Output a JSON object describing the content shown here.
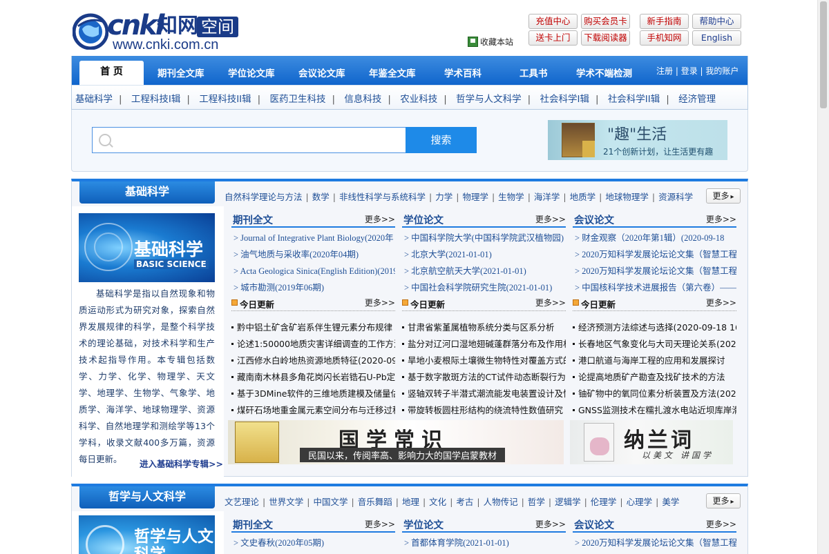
{
  "header": {
    "logo_cnki": "cnki",
    "logo_cn": "知网",
    "logo_kongjian": "空间",
    "logo_url": "www.cnki.com.cn",
    "bookmark": "收藏本站",
    "top_buttons": [
      "充值中心",
      "购买会员卡",
      "新手指南",
      "帮助中心",
      "送卡上门",
      "下载阅读器",
      "手机知网",
      "English"
    ]
  },
  "nav": {
    "home": "首 页",
    "items": [
      "期刊全文库",
      "学位论文库",
      "会议论文库",
      "年鉴全文库",
      "学术百科",
      "工具书",
      "学术不端检测"
    ],
    "user": [
      "注册",
      "登录",
      "我的账户"
    ],
    "subnav": [
      "基础科学",
      "工程科技I辑",
      "工程科技II辑",
      "医药卫生科技",
      "信息科技",
      "农业科技",
      "哲学与人文科学",
      "社会科学I辑",
      "社会科学II辑",
      "经济管理"
    ]
  },
  "search": {
    "placeholder": "",
    "button": "搜索",
    "ad_title": "\"趣\"生活",
    "ad_sub": "21个创新计划，让生活更有趣"
  },
  "section1": {
    "title": "基础科学",
    "links": [
      "自然科学理论与方法",
      "数学",
      "非线性科学与系统科学",
      "力学",
      "物理学",
      "生物学",
      "海洋学",
      "地质学",
      "地球物理学",
      "资源科学"
    ],
    "more": "更多",
    "banner_cn": "基础科学",
    "banner_en": "BASIC SCIENCE",
    "description": "基础科学是指以自然现象和物质运动形式为研究对象，探索自然界发展规律的科学，是整个科学技术的理论基础，对技术科学和生产技术起指导作用。本专辑包括数学、力学、化学、物理学、天文学、地理学、生物学、气象学、地质学、海洋学、地球物理学、资源科学、自然地理学和测绘学等13个学科，收录文献400多万篇，资源每日更新。",
    "enter": "进入基础科学专辑>>",
    "columns": [
      {
        "title": "期刊全文",
        "more": "更多>>",
        "items": [
          "> Journal of Integrative Plant Biology(2020年",
          "> 油气地质与采收率(2020年04期)",
          "> Acta Geologica Sinica(English Edition)(2019",
          "> 城市勘测(2019年06期)"
        ],
        "today_title": "今日更新",
        "today_more": "更多>>",
        "today": [
          "黔中铝土矿含矿岩系伴生锂元素分布规律",
          "论述1:50000地质灾害详细调查的工作方法",
          "江西修水白岭地热资源地质特征(2020-09-",
          "藏南南木林县多角花岗闪长岩锆石U-Pb定年",
          "基于3DMine软件的三维地质建模及储量估",
          "煤矸石场地重金属元素空间分布与迁移过程"
        ]
      },
      {
        "title": "学位论文",
        "more": "更多>>",
        "items": [
          "> 中国科学院大学(中国科学院武汉植物园)",
          "> 北京大学(2021-01-01)",
          "> 北京航空航天大学(2021-01-01)",
          "> 中国社会科学院研究生院(2021-01-01)"
        ],
        "today_title": "今日更新",
        "today_more": "更多>>",
        "today": [
          "甘肃省紫堇属植物系统分类与区系分析",
          "盐分对辽河口湿地翅碱蓬群落分布及作用机",
          "旱地小麦根际土壤微生物特性对覆盖方式的",
          "基于数字散斑方法的CT试件动态断裂行为",
          "竖轴双转子半潜式潮流能发电装置设计及性",
          "带旋转板圆柱形结构的绕流特性数值研究"
        ]
      },
      {
        "title": "会议论文",
        "more": "更多>>",
        "items": [
          "> 财金观察（2020年第1辑）(2020-09-18",
          "> 2020万知科学发展论坛论文集（智慧工程",
          "> 2020万知科学发展论坛论文集（智慧工程",
          "> 中国核科学技术进展报告（第六卷）——"
        ],
        "today_title": "今日更新",
        "today_more": "更多>>",
        "today": [
          "经济预测方法综述与选择(2020-09-18 16:14)",
          "长春地区气象变化与大司天理论关系(2020-",
          "港口航道与海岸工程的应用和发展探讨",
          "论提高地质矿产勘查及找矿技术的方法",
          "铀矿物中的氧同位素分析装置及方法(2020-",
          "GNSS监测技术在糯扎渡水电站近坝库岸滑"
        ]
      }
    ],
    "ad_guoxue_title": "国学常识",
    "ad_guoxue_sub": "民国以来，传阅率高、影响力大的国学启蒙教材",
    "ad_nalan_title": "纳兰词",
    "ad_nalan_sub": "以美文 讲国学"
  },
  "section2": {
    "title": "哲学与人文科学",
    "links": [
      "文艺理论",
      "世界文学",
      "中国文学",
      "音乐舞蹈",
      "地理",
      "文化",
      "考古",
      "人物传记",
      "哲学",
      "逻辑学",
      "伦理学",
      "心理学",
      "美学"
    ],
    "more": "更多",
    "banner_cn": "哲学与人文科学",
    "columns": [
      {
        "title": "期刊全文",
        "more": "更多>>",
        "items": [
          "> 文史春秋(2020年05期)"
        ]
      },
      {
        "title": "学位论文",
        "more": "更多>>",
        "items": [
          "> 首都体育学院(2021-01-01)"
        ]
      },
      {
        "title": "会议论文",
        "more": "更多>>",
        "items": [
          "> 2020万知科学发展论坛论文集（智慧工程"
        ]
      }
    ]
  }
}
